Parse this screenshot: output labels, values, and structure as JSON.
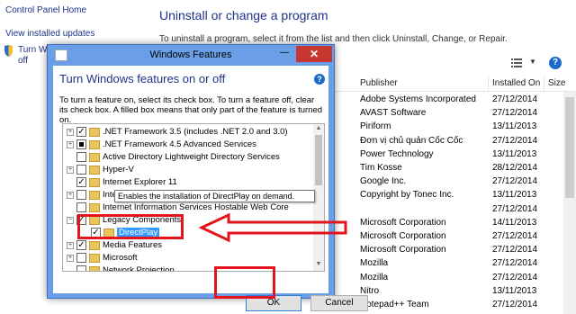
{
  "control_panel": {
    "links": [
      "Control Panel Home",
      "View installed updates",
      "Turn W",
      "off"
    ],
    "title": "Uninstall or change a program",
    "subtitle": "To uninstall a program, select it from the list and then click Uninstall, Change, or Repair.",
    "columns": [
      "Publisher",
      "Installed On",
      "Size"
    ],
    "rows": [
      {
        "publisher": "Adobe Systems Incorporated",
        "date": "27/12/2014"
      },
      {
        "publisher": "AVAST Software",
        "date": "27/12/2014"
      },
      {
        "publisher": "Piriform",
        "date": "13/11/2013"
      },
      {
        "publisher": "Đơn vị chủ quản Cốc Cốc",
        "date": "27/12/2014"
      },
      {
        "publisher": "Power Technology",
        "date": "13/11/2013"
      },
      {
        "publisher": "Tim Kosse",
        "date": "28/12/2014"
      },
      {
        "publisher": "Google Inc.",
        "date": "27/12/2014"
      },
      {
        "publisher": "Copyright by Tonec Inc.",
        "date": "13/11/2013"
      },
      {
        "publisher": "",
        "date": "27/12/2014"
      },
      {
        "publisher": "Microsoft Corporation",
        "date": "14/11/2013"
      },
      {
        "publisher": "Microsoft Corporation",
        "date": "27/12/2014"
      },
      {
        "publisher": "Microsoft Corporation",
        "date": "27/12/2014"
      },
      {
        "publisher": "Mozilla",
        "date": "27/12/2014"
      },
      {
        "publisher": "Mozilla",
        "date": "27/12/2014"
      },
      {
        "publisher": "Nitro",
        "date": "13/11/2013"
      },
      {
        "publisher": "Notepad++ Team",
        "date": "27/12/2014"
      }
    ]
  },
  "dialog": {
    "window_title": "Windows Features",
    "close_glyph": "✕",
    "minimize_glyph": "—",
    "heading": "Turn Windows features on or off",
    "help_glyph": "?",
    "description": "To turn a feature on, select its check box. To turn a feature off, clear its check box. A filled box means that only part of the feature is turned on.",
    "features": [
      {
        "label": ".NET Framework 3.5 (includes .NET 2.0 and 3.0)",
        "state": "checked",
        "expand": "+"
      },
      {
        "label": ".NET Framework 4.5 Advanced Services",
        "state": "partial",
        "expand": "+"
      },
      {
        "label": "Active Directory Lightweight Directory Services",
        "state": "unchecked",
        "expand": ""
      },
      {
        "label": "Hyper-V",
        "state": "unchecked",
        "expand": "+"
      },
      {
        "label": "Internet Explorer 11",
        "state": "checked",
        "expand": ""
      },
      {
        "label": "Internet Information Services",
        "state": "unchecked",
        "expand": "+"
      },
      {
        "label": "Internet Information Services Hostable Web Core",
        "state": "unchecked",
        "expand": ""
      },
      {
        "label": "Legacy Components",
        "state": "checked",
        "expand": "−"
      },
      {
        "label": "DirectPlay",
        "state": "checked",
        "expand": "",
        "selected": true
      },
      {
        "label": "Media Features",
        "state": "checked",
        "expand": "+"
      },
      {
        "label": "Microsoft",
        "state": "unchecked",
        "expand": "+"
      },
      {
        "label": "Network Projection",
        "state": "unchecked",
        "expand": ""
      }
    ],
    "tooltip": "Enables the installation of DirectPlay on demand.",
    "ok_label": "OK",
    "cancel_label": "Cancel"
  },
  "colors": {
    "accent": "#1e3287",
    "annotation": "#e3141b",
    "dialog_frame": "#6a9fe8",
    "close_button": "#c7372f",
    "selection": "#3399ff"
  }
}
